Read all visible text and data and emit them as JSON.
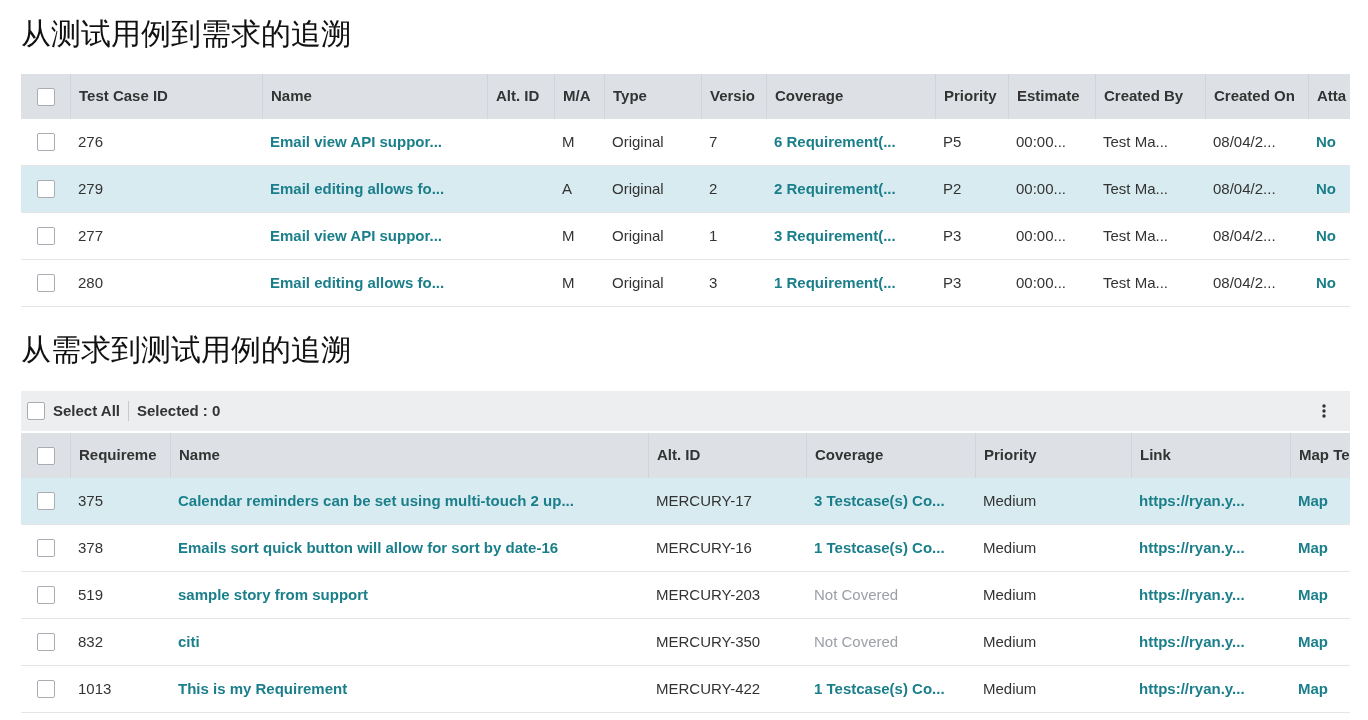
{
  "sections": [
    {
      "title": "从测试用例到需求的追溯",
      "table": {
        "header_checkbox": {
          "checked": false
        },
        "columns": [
          "Test Case ID",
          "Name",
          "Alt. ID",
          "M/A",
          "Type",
          "Versio",
          "Coverage",
          "Priority",
          "Estimate",
          "Created By",
          "Created On",
          "Atta"
        ],
        "rows": [
          {
            "selected": false,
            "checked": false,
            "cells": [
              {
                "text": "276",
                "kind": "text"
              },
              {
                "text": "Email view API suppor...",
                "kind": "link"
              },
              null,
              {
                "text": "M",
                "kind": "text"
              },
              {
                "text": "Original",
                "kind": "text"
              },
              {
                "text": "7",
                "kind": "text"
              },
              {
                "text": "6 Requirement(...",
                "kind": "link"
              },
              {
                "text": "P5",
                "kind": "text"
              },
              {
                "text": "00:00...",
                "kind": "text"
              },
              {
                "text": "Test Ma...",
                "kind": "text"
              },
              {
                "text": "08/04/2...",
                "kind": "text"
              },
              {
                "text": "No",
                "kind": "link"
              }
            ]
          },
          {
            "selected": true,
            "checked": false,
            "cells": [
              {
                "text": "279",
                "kind": "text"
              },
              {
                "text": "Email editing allows fo...",
                "kind": "link"
              },
              null,
              {
                "text": "A",
                "kind": "text"
              },
              {
                "text": "Original",
                "kind": "text"
              },
              {
                "text": "2",
                "kind": "text"
              },
              {
                "text": "2 Requirement(...",
                "kind": "link"
              },
              {
                "text": "P2",
                "kind": "text"
              },
              {
                "text": "00:00...",
                "kind": "text"
              },
              {
                "text": "Test Ma...",
                "kind": "text"
              },
              {
                "text": "08/04/2...",
                "kind": "text"
              },
              {
                "text": "No",
                "kind": "link"
              }
            ]
          },
          {
            "selected": false,
            "checked": false,
            "cells": [
              {
                "text": "277",
                "kind": "text"
              },
              {
                "text": "Email view API suppor...",
                "kind": "link"
              },
              null,
              {
                "text": "M",
                "kind": "text"
              },
              {
                "text": "Original",
                "kind": "text"
              },
              {
                "text": "1",
                "kind": "text"
              },
              {
                "text": "3 Requirement(...",
                "kind": "link"
              },
              {
                "text": "P3",
                "kind": "text"
              },
              {
                "text": "00:00...",
                "kind": "text"
              },
              {
                "text": "Test Ma...",
                "kind": "text"
              },
              {
                "text": "08/04/2...",
                "kind": "text"
              },
              {
                "text": "No",
                "kind": "link"
              }
            ]
          },
          {
            "selected": false,
            "checked": false,
            "cells": [
              {
                "text": "280",
                "kind": "text"
              },
              {
                "text": "Email editing allows fo...",
                "kind": "link"
              },
              null,
              {
                "text": "M",
                "kind": "text"
              },
              {
                "text": "Original",
                "kind": "text"
              },
              {
                "text": "3",
                "kind": "text"
              },
              {
                "text": "1 Requirement(...",
                "kind": "link"
              },
              {
                "text": "P3",
                "kind": "text"
              },
              {
                "text": "00:00...",
                "kind": "text"
              },
              {
                "text": "Test Ma...",
                "kind": "text"
              },
              {
                "text": "08/04/2...",
                "kind": "text"
              },
              {
                "text": "No",
                "kind": "link"
              }
            ]
          }
        ]
      }
    },
    {
      "title": "从需求到测试用例的追溯",
      "toolbar": {
        "select_all": {
          "label": "Select All",
          "checked": false
        },
        "selected_count": "Selected : 0"
      },
      "table": {
        "header_checkbox": {
          "checked": false
        },
        "columns": [
          "Requireme",
          "Name",
          "Alt. ID",
          "Coverage",
          "Priority",
          "Link",
          "Map Te"
        ],
        "rows": [
          {
            "selected": true,
            "checked": false,
            "cells": [
              {
                "text": "375",
                "kind": "text"
              },
              {
                "text": "Calendar reminders can be set using multi-touch 2 up...",
                "kind": "link"
              },
              {
                "text": "MERCURY-17",
                "kind": "text"
              },
              {
                "text": "3 Testcase(s) Co...",
                "kind": "link"
              },
              {
                "text": "Medium",
                "kind": "text"
              },
              {
                "text": "https://ryan.y...",
                "kind": "link"
              },
              {
                "text": "Map",
                "kind": "link"
              }
            ]
          },
          {
            "selected": false,
            "checked": false,
            "cells": [
              {
                "text": "378",
                "kind": "text"
              },
              {
                "text": "Emails sort quick button will allow for sort by date-16",
                "kind": "link"
              },
              {
                "text": "MERCURY-16",
                "kind": "text"
              },
              {
                "text": "1 Testcase(s) Co...",
                "kind": "link"
              },
              {
                "text": "Medium",
                "kind": "text"
              },
              {
                "text": "https://ryan.y...",
                "kind": "link"
              },
              {
                "text": "Map",
                "kind": "link"
              }
            ]
          },
          {
            "selected": false,
            "checked": false,
            "cells": [
              {
                "text": "519",
                "kind": "text"
              },
              {
                "text": "sample story from support",
                "kind": "link"
              },
              {
                "text": "MERCURY-203",
                "kind": "text"
              },
              {
                "text": "Not Covered",
                "kind": "muted"
              },
              {
                "text": "Medium",
                "kind": "text"
              },
              {
                "text": "https://ryan.y...",
                "kind": "link"
              },
              {
                "text": "Map",
                "kind": "link"
              }
            ]
          },
          {
            "selected": false,
            "checked": false,
            "cells": [
              {
                "text": "832",
                "kind": "text"
              },
              {
                "text": "citi",
                "kind": "link"
              },
              {
                "text": "MERCURY-350",
                "kind": "text"
              },
              {
                "text": "Not Covered",
                "kind": "muted"
              },
              {
                "text": "Medium",
                "kind": "text"
              },
              {
                "text": "https://ryan.y...",
                "kind": "link"
              },
              {
                "text": "Map",
                "kind": "link"
              }
            ]
          },
          {
            "selected": false,
            "checked": false,
            "cells": [
              {
                "text": "1013",
                "kind": "text"
              },
              {
                "text": "This is my Requirement",
                "kind": "link"
              },
              {
                "text": "MERCURY-422",
                "kind": "text"
              },
              {
                "text": "1 Testcase(s) Co...",
                "kind": "link"
              },
              {
                "text": "Medium",
                "kind": "text"
              },
              {
                "text": "https://ryan.y...",
                "kind": "link"
              },
              {
                "text": "Map",
                "kind": "link"
              }
            ]
          }
        ]
      }
    }
  ]
}
